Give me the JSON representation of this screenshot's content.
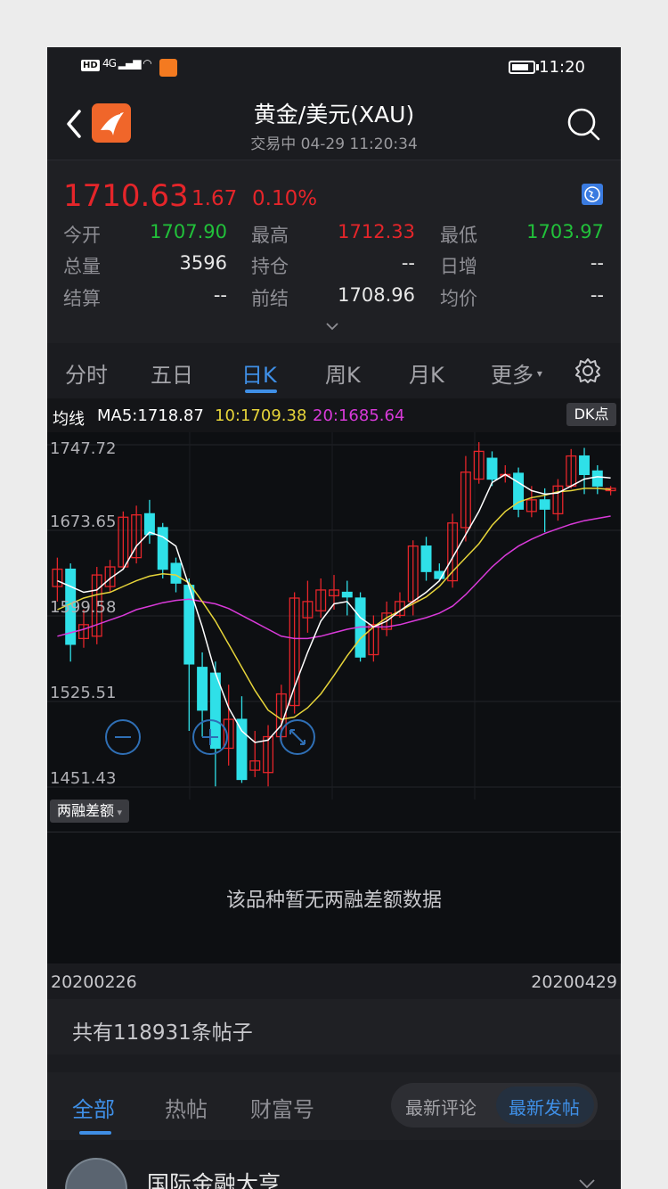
{
  "status_bar": {
    "time": "11:20",
    "network": "4G",
    "hd": "HD"
  },
  "header": {
    "title": "黄金/美元(XAU)",
    "subtitle": "交易中  04-29 11:20:34"
  },
  "quote": {
    "price": "1710.63",
    "change": "1.67",
    "change_pct": "0.10%",
    "rows": [
      [
        {
          "label": "今开",
          "value": "1707.90",
          "color": "#21c13a"
        },
        {
          "label": "最高",
          "value": "1712.33",
          "color": "#e5252a"
        },
        {
          "label": "最低",
          "value": "1703.97",
          "color": "#21c13a"
        }
      ],
      [
        {
          "label": "总量",
          "value": "3596",
          "color": "#e8e8e8"
        },
        {
          "label": "持仓",
          "value": "--",
          "color": "#e8e8e8"
        },
        {
          "label": "日增",
          "value": "--",
          "color": "#e8e8e8"
        }
      ],
      [
        {
          "label": "结算",
          "value": "--",
          "color": "#e8e8e8"
        },
        {
          "label": "前结",
          "value": "1708.96",
          "color": "#e8e8e8"
        },
        {
          "label": "均价",
          "value": "--",
          "color": "#e8e8e8"
        }
      ]
    ]
  },
  "tabs": [
    "分时",
    "五日",
    "日K",
    "周K",
    "月K",
    "更多"
  ],
  "active_tab": "日K",
  "ma": {
    "prefix": "均线",
    "ma5": "MA5:1718.87",
    "ma10": "10:1709.38",
    "ma20": "20:1685.64",
    "dk": "DK点"
  },
  "colors": {
    "up": "#e5252a",
    "down": "#2fe0e8",
    "ma5": "#ffffff",
    "ma10": "#e6d43a",
    "ma20": "#d93ad9",
    "accent": "#3f8fe6"
  },
  "chart_data": {
    "type": "candlestick",
    "y_ticks": [
      "1747.72",
      "1673.65",
      "1599.58",
      "1525.51",
      "1451.43"
    ],
    "ylim": [
      1451.43,
      1747.72
    ],
    "x_start": "20200226",
    "x_end": "20200429",
    "candles": [
      {
        "o": 1625,
        "c": 1640,
        "h": 1650,
        "l": 1612
      },
      {
        "o": 1640,
        "c": 1575,
        "h": 1645,
        "l": 1560
      },
      {
        "o": 1580,
        "c": 1592,
        "h": 1605,
        "l": 1572
      },
      {
        "o": 1582,
        "c": 1635,
        "h": 1642,
        "l": 1575
      },
      {
        "o": 1625,
        "c": 1642,
        "h": 1648,
        "l": 1620
      },
      {
        "o": 1642,
        "c": 1685,
        "h": 1690,
        "l": 1640
      },
      {
        "o": 1650,
        "c": 1687,
        "h": 1695,
        "l": 1645
      },
      {
        "o": 1688,
        "c": 1670,
        "h": 1700,
        "l": 1662
      },
      {
        "o": 1676,
        "c": 1640,
        "h": 1680,
        "l": 1632
      },
      {
        "o": 1645,
        "c": 1628,
        "h": 1650,
        "l": 1620
      },
      {
        "o": 1626,
        "c": 1558,
        "h": 1632,
        "l": 1500
      },
      {
        "o": 1555,
        "c": 1518,
        "h": 1568,
        "l": 1495
      },
      {
        "o": 1550,
        "c": 1485,
        "h": 1560,
        "l": 1452
      },
      {
        "o": 1485,
        "c": 1510,
        "h": 1540,
        "l": 1470
      },
      {
        "o": 1510,
        "c": 1458,
        "h": 1530,
        "l": 1455
      },
      {
        "o": 1466,
        "c": 1474,
        "h": 1500,
        "l": 1460
      },
      {
        "o": 1464,
        "c": 1495,
        "h": 1505,
        "l": 1452
      },
      {
        "o": 1495,
        "c": 1532,
        "h": 1540,
        "l": 1490
      },
      {
        "o": 1522,
        "c": 1615,
        "h": 1620,
        "l": 1515
      },
      {
        "o": 1598,
        "c": 1612,
        "h": 1630,
        "l": 1585
      },
      {
        "o": 1604,
        "c": 1622,
        "h": 1632,
        "l": 1598
      },
      {
        "o": 1617,
        "c": 1622,
        "h": 1635,
        "l": 1605
      },
      {
        "o": 1620,
        "c": 1616,
        "h": 1630,
        "l": 1600
      },
      {
        "o": 1615,
        "c": 1564,
        "h": 1620,
        "l": 1560
      },
      {
        "o": 1566,
        "c": 1592,
        "h": 1600,
        "l": 1560
      },
      {
        "o": 1588,
        "c": 1602,
        "h": 1612,
        "l": 1582
      },
      {
        "o": 1600,
        "c": 1612,
        "h": 1620,
        "l": 1598
      },
      {
        "o": 1612,
        "c": 1660,
        "h": 1665,
        "l": 1600
      },
      {
        "o": 1660,
        "c": 1638,
        "h": 1668,
        "l": 1630
      },
      {
        "o": 1638,
        "c": 1632,
        "h": 1645,
        "l": 1630
      },
      {
        "o": 1630,
        "c": 1680,
        "h": 1688,
        "l": 1624
      },
      {
        "o": 1676,
        "c": 1724,
        "h": 1738,
        "l": 1664
      },
      {
        "o": 1718,
        "c": 1742,
        "h": 1750,
        "l": 1714
      },
      {
        "o": 1736,
        "c": 1718,
        "h": 1742,
        "l": 1712
      },
      {
        "o": 1722,
        "c": 1722,
        "h": 1730,
        "l": 1715
      },
      {
        "o": 1723,
        "c": 1692,
        "h": 1728,
        "l": 1685
      },
      {
        "o": 1690,
        "c": 1700,
        "h": 1712,
        "l": 1685
      },
      {
        "o": 1700,
        "c": 1692,
        "h": 1710,
        "l": 1672
      },
      {
        "o": 1688,
        "c": 1712,
        "h": 1718,
        "l": 1682
      },
      {
        "o": 1712,
        "c": 1738,
        "h": 1744,
        "l": 1710
      },
      {
        "o": 1738,
        "c": 1722,
        "h": 1745,
        "l": 1705
      },
      {
        "o": 1725,
        "c": 1712,
        "h": 1730,
        "l": 1705
      },
      {
        "o": 1708,
        "c": 1710,
        "h": 1712,
        "l": 1704
      }
    ],
    "ma5": [
      1630,
      1625,
      1620,
      1622,
      1632,
      1640,
      1660,
      1672,
      1668,
      1660,
      1625,
      1590,
      1550,
      1520,
      1500,
      1490,
      1492,
      1505,
      1538,
      1568,
      1595,
      1610,
      1612,
      1598,
      1590,
      1595,
      1604,
      1612,
      1620,
      1630,
      1650,
      1670,
      1690,
      1715,
      1722,
      1715,
      1708,
      1705,
      1706,
      1712,
      1718,
      1720,
      1719
    ],
    "ma10": [
      1605,
      1610,
      1615,
      1618,
      1620,
      1625,
      1630,
      1634,
      1636,
      1635,
      1628,
      1612,
      1595,
      1575,
      1555,
      1535,
      1518,
      1510,
      1512,
      1520,
      1532,
      1548,
      1565,
      1580,
      1590,
      1598,
      1604,
      1610,
      1616,
      1625,
      1638,
      1650,
      1662,
      1678,
      1690,
      1698,
      1702,
      1704,
      1707,
      1708,
      1710,
      1710,
      1709
    ],
    "ma20": [
      1582,
      1585,
      1588,
      1592,
      1596,
      1600,
      1605,
      1608,
      1611,
      1613,
      1614,
      1612,
      1610,
      1606,
      1600,
      1594,
      1588,
      1582,
      1580,
      1580,
      1582,
      1585,
      1588,
      1590,
      1590,
      1590,
      1592,
      1595,
      1598,
      1602,
      1608,
      1618,
      1630,
      1642,
      1652,
      1660,
      1666,
      1671,
      1675,
      1679,
      1682,
      1684,
      1686
    ]
  },
  "sub_chart": {
    "selector": "两融差额",
    "empty": "该品种暂无两融差额数据"
  },
  "posts": {
    "count": "共有118931条帖子",
    "tabs": [
      "全部",
      "热帖",
      "财富号"
    ],
    "sort": [
      "最新评论",
      "最新发帖"
    ],
    "first_author": "国际金融大亨"
  }
}
